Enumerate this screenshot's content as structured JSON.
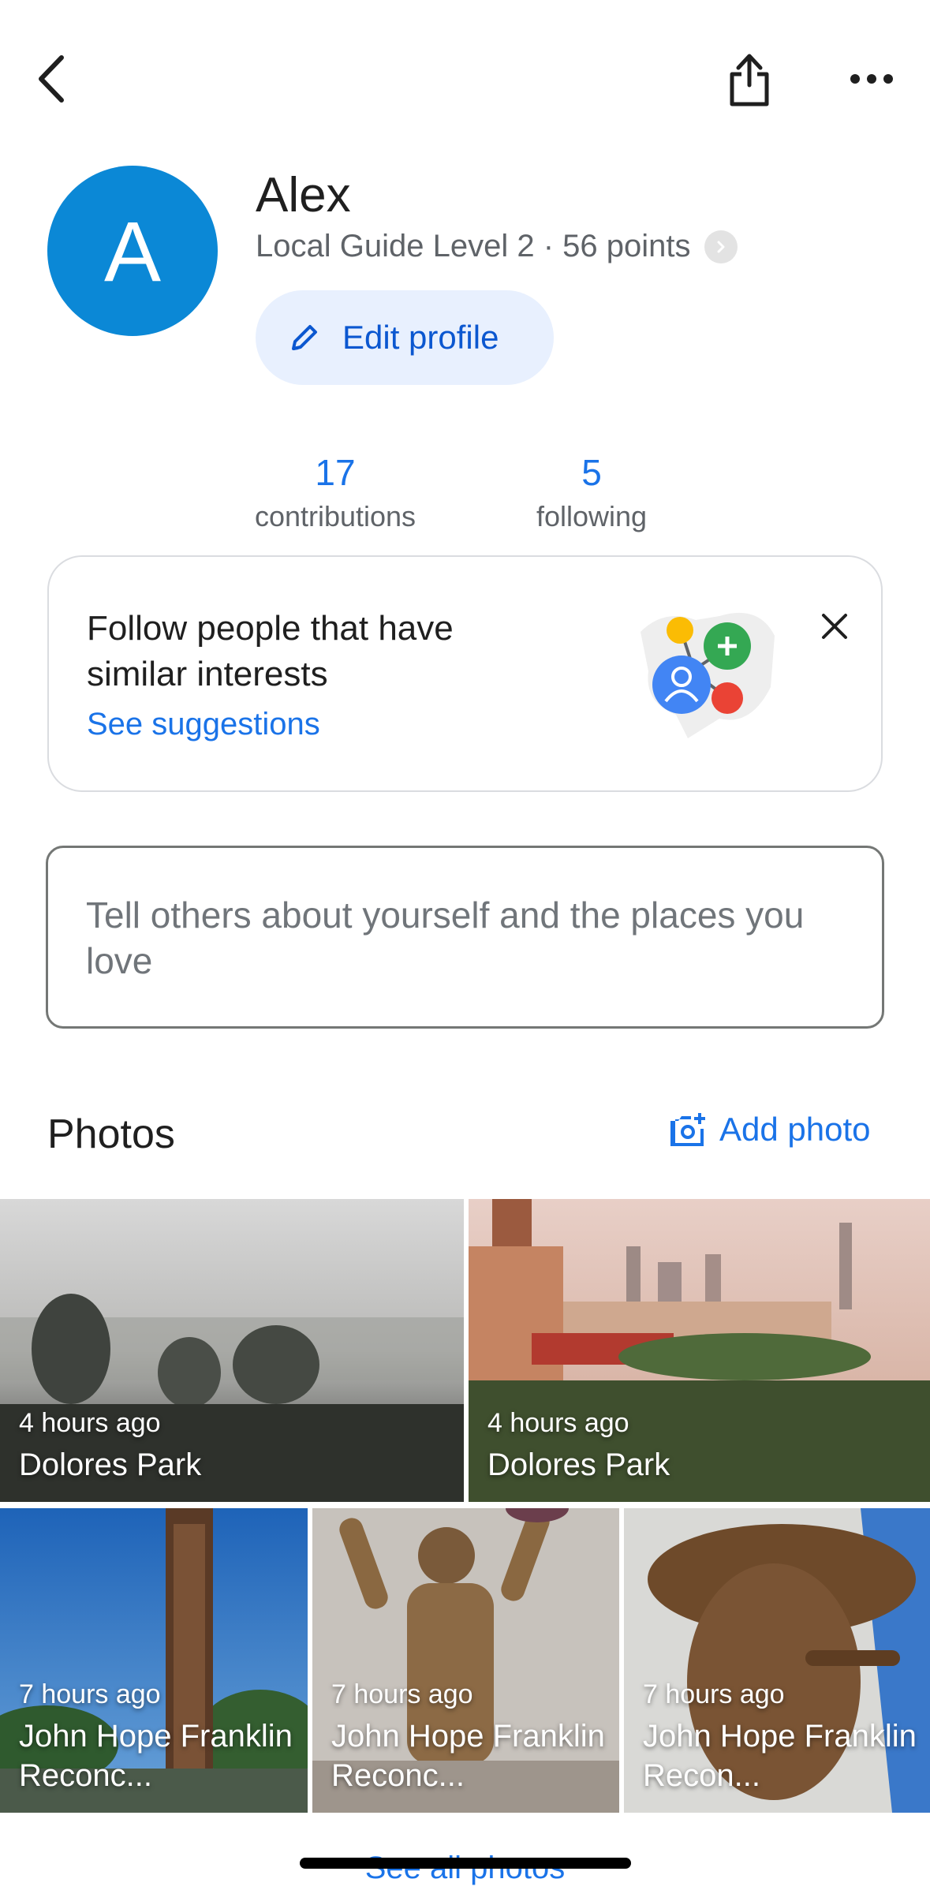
{
  "header": {
    "back_icon": "chevron-left-icon",
    "share_icon": "share-icon",
    "more_icon": "more-horizontal-icon"
  },
  "profile": {
    "avatar_letter": "A",
    "avatar_color": "#0b88d6",
    "name": "Alex",
    "level": "Local Guide Level 2 · 56 points",
    "edit_label": "Edit profile"
  },
  "stats": [
    {
      "value": "17",
      "label": "contributions"
    },
    {
      "value": "5",
      "label": "following"
    }
  ],
  "follow_card": {
    "title": "Follow people that have similar interests",
    "link": "See suggestions"
  },
  "about": {
    "placeholder": "Tell others about yourself and the places you love"
  },
  "photos": {
    "title": "Photos",
    "add_label": "Add photo",
    "items": [
      {
        "time": "4 hours ago",
        "place": "Dolores Park"
      },
      {
        "time": "4 hours ago",
        "place": "Dolores Park"
      },
      {
        "time": "7 hours ago",
        "place": "John Hope Franklin Reconc..."
      },
      {
        "time": "7 hours ago",
        "place": "John Hope Franklin Reconc..."
      },
      {
        "time": "7 hours ago",
        "place": "John Hope Franklin Recon..."
      }
    ],
    "see_all": "See all photos"
  },
  "colors": {
    "accent": "#1a73e8",
    "edit_bg": "#e8f0fe"
  }
}
